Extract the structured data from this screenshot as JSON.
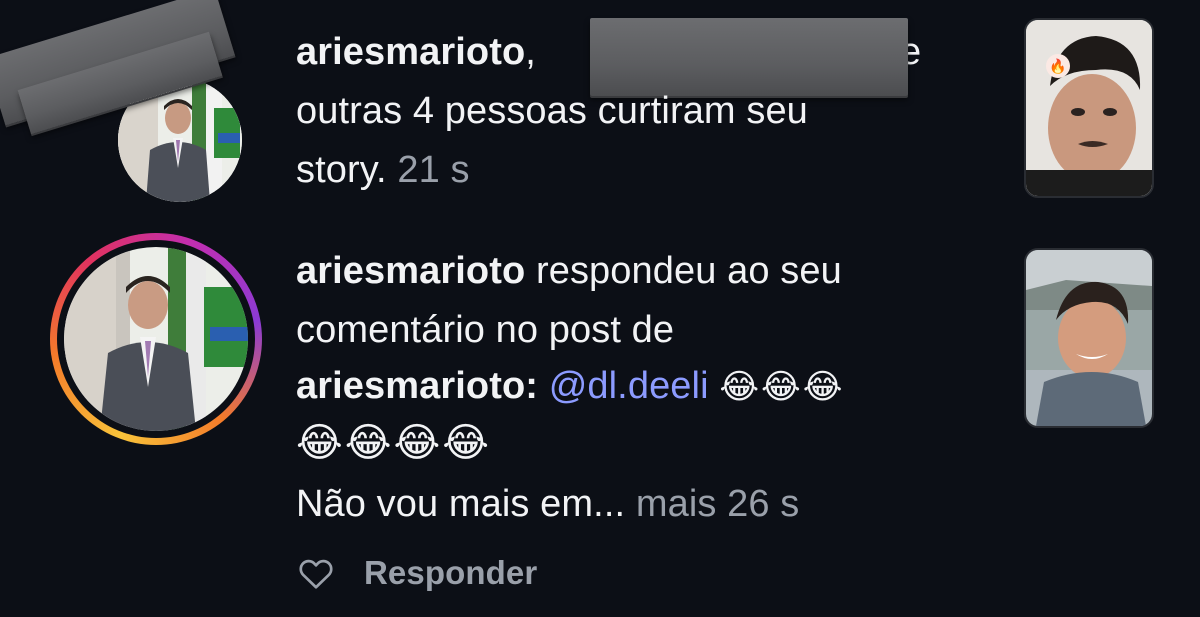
{
  "notifications": [
    {
      "username": "ariesmarioto",
      "line1_suffix": ",",
      "line1_tail": "e",
      "line2": "outras 4 pessoas curtiram seu",
      "line3_text": "story.",
      "timestamp": "21 s"
    },
    {
      "username": "ariesmarioto",
      "line1_text": "respondeu ao seu",
      "line2": "comentário no post de",
      "line3_username": "ariesmarioto:",
      "mention": "@dl.deeli",
      "emoji_line3": "😂😂😂",
      "emoji_line4": "😂😂😂😂",
      "line5_text": "Não vou mais em...",
      "more_label": "mais",
      "timestamp": "26 s",
      "reply_label": "Responder"
    }
  ],
  "icons": {
    "like": "heart-outline-icon",
    "fire": "fire-icon"
  },
  "colors": {
    "background": "#0c0f16",
    "text": "#f2f3f5",
    "muted": "#9aa0aa",
    "mention": "#8c9bff"
  }
}
